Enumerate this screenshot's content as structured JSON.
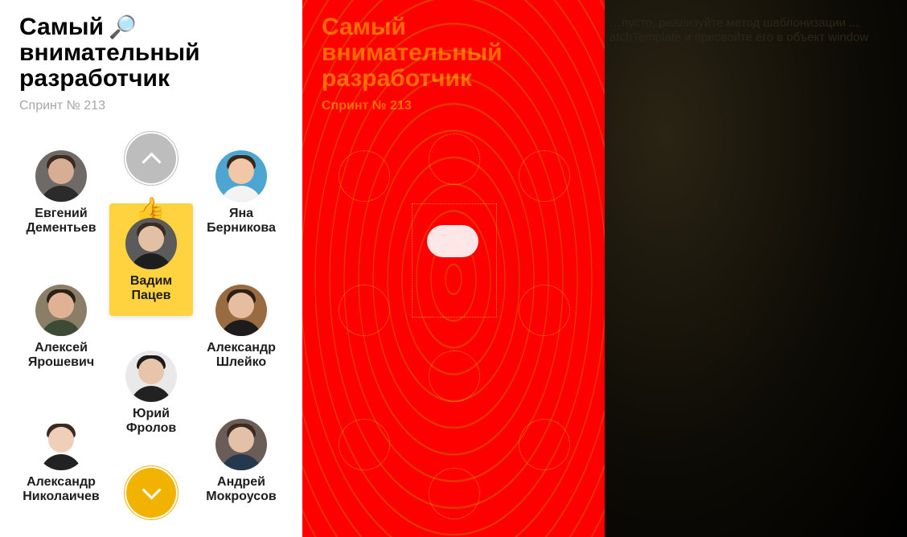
{
  "title": {
    "line1": "Самый",
    "line2": "внимательный",
    "line3": "разработчик",
    "emoji": "🔎",
    "icon": "magnifier-icon"
  },
  "subtitle": "Спринт № 213",
  "people": [
    {
      "first": "Евгений",
      "last": "Дементьев",
      "colors": {
        "bg": "#6f6a65",
        "head": "#d7ad93",
        "hair": "#3a2a20",
        "body": "#2b2b2b"
      }
    },
    {
      "first": "Яна",
      "last": "Берникова",
      "colors": {
        "bg": "#4da6d2",
        "head": "#f1c7a8",
        "hair": "#3a2616",
        "body": "#f3f3f3"
      }
    },
    {
      "first": "Алексей",
      "last": "Ярошевич",
      "colors": {
        "bg": "#8a7f66",
        "head": "#e0b192",
        "hair": "#2b2018",
        "body": "#3d4a35"
      }
    },
    {
      "first": "Александр",
      "last": "Шлейко",
      "colors": {
        "bg": "#9a6b40",
        "head": "#e6be9f",
        "hair": "#2c1f16",
        "body": "#1c1c1c"
      }
    },
    {
      "first": "Юрий",
      "last": "Фролов",
      "colors": {
        "bg": "#e9e9e9",
        "head": "#e8c4aa",
        "hair": "#1f1a17",
        "body": "#222222"
      }
    },
    {
      "first": "Александр",
      "last": "Николаичев",
      "colors": {
        "bg": "#ffffff",
        "head": "#efcfb8",
        "hair": "#3a2a20",
        "body": "#222222"
      }
    },
    {
      "first": "Андрей",
      "last": "Мокроусов",
      "colors": {
        "bg": "#6a5c56",
        "head": "#e3c1a8",
        "hair": "#3b2a1f",
        "body": "#24384e"
      }
    }
  ],
  "leader": {
    "first": "Вадим",
    "last": "Пацев",
    "badge_emoji": "👍",
    "badge_icon": "thumbs-up-icon",
    "card_color": "#ffd23f",
    "colors": {
      "bg": "#5b5b5b",
      "head": "#e2c0a3",
      "hair": "#3a2a20",
      "body": "#1e1e1e"
    }
  },
  "nav": {
    "up_icon": "chevron-up-icon",
    "down_icon": "chevron-down-icon",
    "up_color": "#bdbdbd",
    "down_color": "#f2b200"
  },
  "hint": {
    "text": "…пусто, реализуйте метод шаблонизации ... atchTemplate и присвойте его в объект window"
  }
}
